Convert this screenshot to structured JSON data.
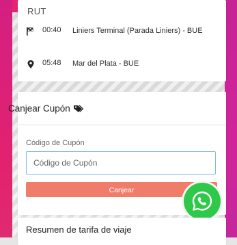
{
  "route": {
    "label": "RUT",
    "stops": [
      {
        "icon": "flag-icon",
        "time": "00:40",
        "name": "Liniers Terminal (Parada Liniers) - BUE"
      },
      {
        "icon": "map-pin-icon",
        "time": "05:48",
        "name": "Mar del Plata - BUE"
      }
    ]
  },
  "coupon": {
    "title": "Canjear Cupón",
    "title_icon": "tag-icon",
    "field_label": "Código de Cupón",
    "placeholder": "Código de Cupón",
    "value": "",
    "button_label": "Canjear",
    "button_color": "#f07d6a"
  },
  "whatsapp": {
    "icon": "whatsapp-icon",
    "color": "#2fc94a"
  },
  "summary": {
    "title": "Resumen de tarifa de viaje"
  },
  "colors": {
    "brand_pink": "#e02472",
    "accent_blue": "#7db7ea"
  }
}
